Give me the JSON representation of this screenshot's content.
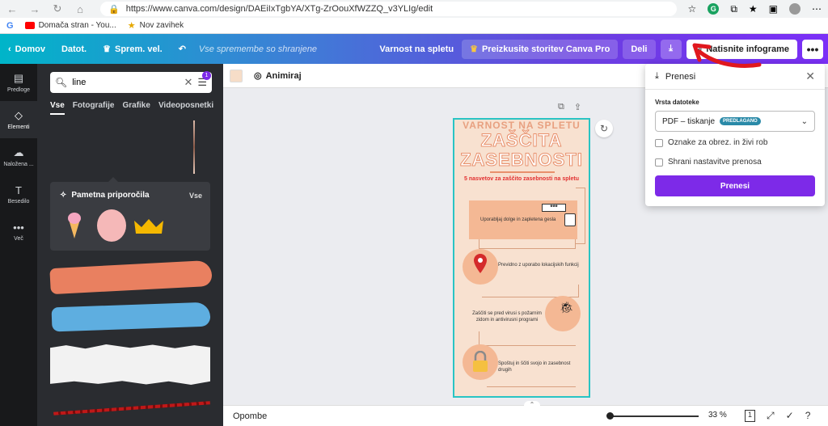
{
  "browser": {
    "url": "https://www.canva.com/design/DAEiIxTgbYA/XTg-ZrOouXfWZZQ_v3YLIg/edit",
    "bookmarks": [
      "Domača stran - You...",
      "Nov zavihek"
    ]
  },
  "topbar": {
    "home": "Domov",
    "file": "Datot.",
    "resize": "Sprem. vel.",
    "saved": "Vse spremembe so shranjene",
    "title": "Varnost na spletu",
    "pro": "Preizkusite storitev Canva Pro",
    "share": "Deli",
    "print": "Natisnite infograme",
    "more": "•••"
  },
  "rail": [
    {
      "label": "Predloge",
      "icon": "template-icon"
    },
    {
      "label": "Elementi",
      "icon": "elements-icon"
    },
    {
      "label": "Naložena ...",
      "icon": "upload-icon"
    },
    {
      "label": "Besedilo",
      "icon": "text-icon"
    },
    {
      "label": "Več",
      "icon": "more-icon"
    }
  ],
  "panel": {
    "search_value": "line",
    "filter_count": "1",
    "tabs": [
      "Vse",
      "Fotografije",
      "Grafike",
      "Videoposnetki"
    ],
    "smart_title": "Pametna priporočila",
    "smart_all": "Vse"
  },
  "canvas_toolbar": {
    "animate": "Animiraj"
  },
  "design": {
    "supertitle": "VARNOST NA SPLETU",
    "title_line1": "ZAŠČITA",
    "title_line2": "ZASEBNOSTI",
    "subtitle": "5 nasvetov za zaščito zasebnosti na spletu",
    "password_mask": "***",
    "tip1": "Uporabljaj dolge in zapletena gesla",
    "tip2": "Previdno z uporabo lokacijskih funkcij",
    "tip3a": "Zaščiti se pred virusi s požarnim",
    "tip3b": "zidom in antivirusni programi",
    "tip4a": "Spoštuj in ščiti svojo in zasebnost",
    "tip4b": "drugih"
  },
  "download": {
    "title": "Prenesi",
    "file_type_label": "Vrsta datoteke",
    "file_type": "PDF – tiskanje",
    "badge": "PREDLAGANO",
    "option1": "Oznake za obrez. in živi rob",
    "option2": "Shrani nastavitve prenosa",
    "button": "Prenesi"
  },
  "bottom": {
    "notes": "Opombe",
    "zoom": "33 %",
    "page": "1"
  },
  "colors": {
    "accent": "#7d2ae8",
    "design_bg": "#f8e1d0",
    "selection": "#29c4c4"
  }
}
